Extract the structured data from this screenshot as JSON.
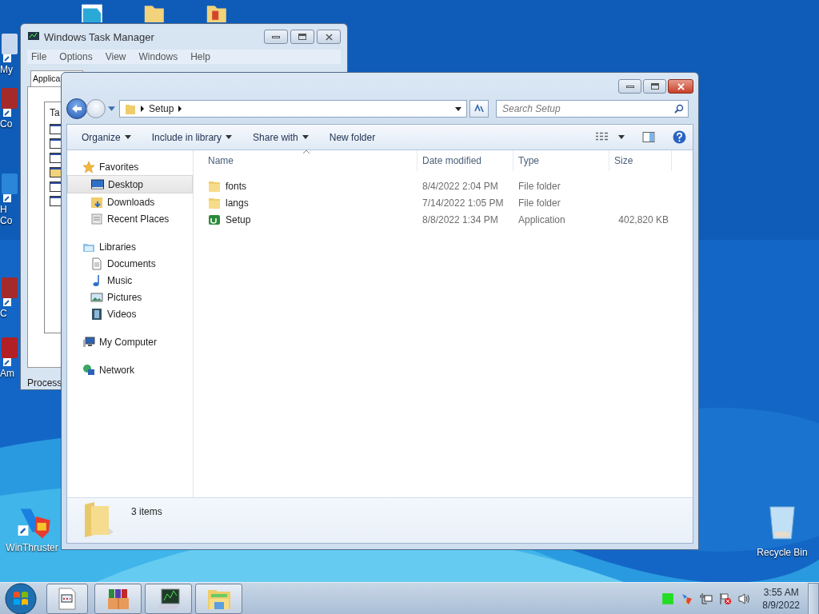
{
  "desktop": {
    "icons": [
      {
        "label": "My",
        "kind": "computer"
      },
      {
        "label": "Co",
        "kind": "app"
      },
      {
        "label": "H Co",
        "kind": "globe"
      },
      {
        "label": "C",
        "kind": "app"
      },
      {
        "label": "Am",
        "kind": "red"
      },
      {
        "label": "WinThruster",
        "kind": "winthruster"
      },
      {
        "label": "Recycle Bin",
        "kind": "bin"
      }
    ]
  },
  "task_manager": {
    "title": "Windows Task Manager",
    "menu": [
      "File",
      "Options",
      "View",
      "Windows",
      "Help"
    ],
    "tabs": [
      {
        "label": "Applica",
        "selected": true
      }
    ],
    "list_header": "Ta",
    "status_bar": "Process"
  },
  "explorer": {
    "address": [
      "Setup"
    ],
    "search": {
      "placeholder": "Search Setup"
    },
    "toolbar": [
      {
        "label": "Organize",
        "dropdown": true
      },
      {
        "label": "Include in library",
        "dropdown": true
      },
      {
        "label": "Share with",
        "dropdown": true
      },
      {
        "label": "New folder",
        "dropdown": false
      }
    ],
    "navigation": [
      {
        "label": "Favorites",
        "kind": "star",
        "children": [
          {
            "label": "Desktop",
            "kind": "desktop",
            "selected": true
          },
          {
            "label": "Downloads",
            "kind": "downloads",
            "selected": false
          },
          {
            "label": "Recent Places",
            "kind": "recent",
            "selected": false
          }
        ]
      },
      {
        "label": "Libraries",
        "kind": "library",
        "children": [
          {
            "label": "Documents",
            "kind": "documents",
            "selected": false
          },
          {
            "label": "Music",
            "kind": "music",
            "selected": false
          },
          {
            "label": "Pictures",
            "kind": "pictures",
            "selected": false
          },
          {
            "label": "Videos",
            "kind": "videos",
            "selected": false
          }
        ]
      },
      {
        "label": "My Computer",
        "kind": "computer"
      },
      {
        "label": "Network",
        "kind": "network"
      }
    ],
    "columns": [
      "Name",
      "Date modified",
      "Type",
      "Size"
    ],
    "files": [
      {
        "name": "fonts",
        "date": "8/4/2022 2:04 PM",
        "type": "File folder",
        "kind": "folder"
      },
      {
        "name": "langs",
        "date": "7/14/2022 1:05 PM",
        "type": "File folder",
        "kind": "folder"
      },
      {
        "name": "Setup",
        "date": "8/8/2022 1:34 PM",
        "type": "Application",
        "size": "402,820 KB",
        "kind": "app"
      }
    ],
    "status": "3 items"
  },
  "taskbar": {
    "clock": {
      "time": "3:55 AM",
      "date": "8/9/2022"
    }
  }
}
